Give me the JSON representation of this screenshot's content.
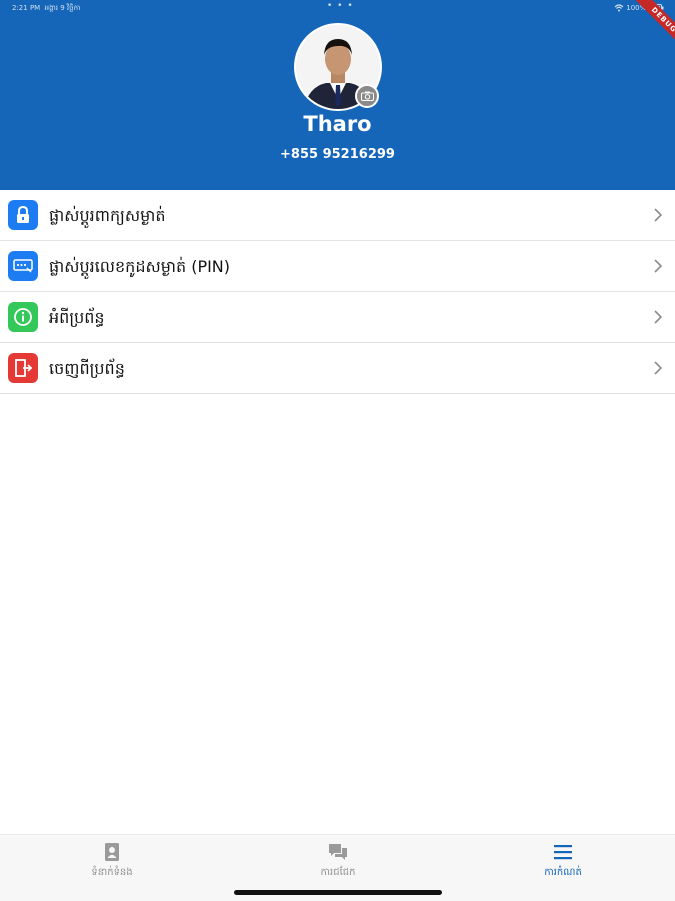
{
  "status_bar": {
    "time": "2:21 PM",
    "date": "អង្គារ 9 វិច្ឆិកា",
    "dots": "• • •",
    "battery": "100%"
  },
  "debug_banner": "DEBUG",
  "profile": {
    "name": "Tharo",
    "phone": "+855 95216299"
  },
  "menu": {
    "items": [
      {
        "label": "ផ្លាស់ប្តូរពាក្យសម្ងាត់",
        "icon": "lock-icon",
        "color": "#1e7cf2"
      },
      {
        "label": "ផ្លាស់ប្តូរលេខកូដសម្ងាត់ (PIN)",
        "icon": "pin-keypad-icon",
        "color": "#1e7cf2"
      },
      {
        "label": "អំពីប្រព័ន្ធ",
        "icon": "info-icon",
        "color": "#34c759"
      },
      {
        "label": "ចេញពីប្រព័ន្ធ",
        "icon": "logout-icon",
        "color": "#e53935"
      }
    ]
  },
  "bottom_nav": {
    "items": [
      {
        "label": "ទំនាក់ទំនង",
        "icon": "contact-book-icon",
        "active": false
      },
      {
        "label": "ការជជែក",
        "icon": "chat-bubbles-icon",
        "active": false
      },
      {
        "label": "ការកំណត់",
        "icon": "menu-icon",
        "active": true
      }
    ]
  },
  "colors": {
    "header": "#1565b8",
    "accent": "#1565b8",
    "blue_icon": "#1e7cf2",
    "green_icon": "#34c759",
    "red_icon": "#e53935"
  }
}
